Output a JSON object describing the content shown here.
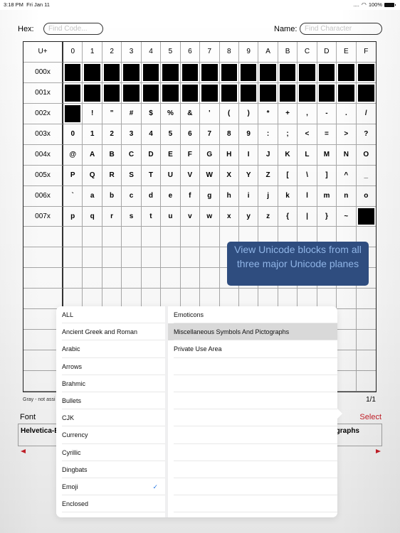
{
  "status_bar": {
    "time": "3:18 PM",
    "date": "Fri Jan 11",
    "signal": "....",
    "battery_percent": "100%"
  },
  "search": {
    "hex_label": "Hex:",
    "hex_placeholder": "Find Code...",
    "name_label": "Name:",
    "name_placeholder": "Find Character"
  },
  "grid": {
    "corner": "U+",
    "col_headers": [
      "0",
      "1",
      "2",
      "3",
      "4",
      "5",
      "6",
      "7",
      "8",
      "9",
      "A",
      "B",
      "C",
      "D",
      "E",
      "F"
    ],
    "rows": [
      {
        "label": "000x",
        "cells": [
          "■",
          "■",
          "■",
          "■",
          "■",
          "■",
          "■",
          "■",
          "■",
          "■",
          "■",
          "■",
          "■",
          "■",
          "■",
          "■"
        ]
      },
      {
        "label": "001x",
        "cells": [
          "■",
          "■",
          "■",
          "■",
          "■",
          "■",
          "■",
          "■",
          "■",
          "■",
          "■",
          "■",
          "■",
          "■",
          "■",
          "■"
        ]
      },
      {
        "label": "002x",
        "cells": [
          "■",
          "!",
          "\"",
          "#",
          "$",
          "%",
          "&",
          "'",
          "(",
          ")",
          "*",
          "+",
          ",",
          "-",
          ".",
          "/"
        ]
      },
      {
        "label": "003x",
        "cells": [
          "0",
          "1",
          "2",
          "3",
          "4",
          "5",
          "6",
          "7",
          "8",
          "9",
          ":",
          ";",
          "<",
          "=",
          ">",
          "?"
        ]
      },
      {
        "label": "004x",
        "cells": [
          "@",
          "A",
          "B",
          "C",
          "D",
          "E",
          "F",
          "G",
          "H",
          "I",
          "J",
          "K",
          "L",
          "M",
          "N",
          "O"
        ]
      },
      {
        "label": "005x",
        "cells": [
          "P",
          "Q",
          "R",
          "S",
          "T",
          "U",
          "V",
          "W",
          "X",
          "Y",
          "Z",
          "[",
          "\\",
          "]",
          "^",
          "_"
        ]
      },
      {
        "label": "006x",
        "cells": [
          "`",
          "a",
          "b",
          "c",
          "d",
          "e",
          "f",
          "g",
          "h",
          "i",
          "j",
          "k",
          "l",
          "m",
          "n",
          "o"
        ]
      },
      {
        "label": "007x",
        "cells": [
          "p",
          "q",
          "r",
          "s",
          "t",
          "u",
          "v",
          "w",
          "x",
          "y",
          "z",
          "{",
          "|",
          "}",
          "~",
          "■"
        ]
      },
      {
        "label": "",
        "cells": [
          "",
          "",
          "",
          "",
          "",
          "",
          "",
          "",
          "",
          "",
          "",
          "",
          "",
          "",
          "",
          ""
        ]
      },
      {
        "label": "",
        "cells": [
          "",
          "",
          "",
          "",
          "",
          "",
          "",
          "",
          "",
          "",
          "",
          "",
          "",
          "",
          "",
          ""
        ]
      },
      {
        "label": "",
        "cells": [
          "",
          "",
          "",
          "",
          "",
          "",
          "",
          "",
          "",
          "",
          "",
          "",
          "",
          "",
          "",
          ""
        ]
      },
      {
        "label": "",
        "cells": [
          "",
          "",
          "",
          "",
          "",
          "",
          "",
          "",
          "",
          "",
          "",
          "",
          "",
          "",
          "",
          ""
        ]
      },
      {
        "label": "",
        "cells": [
          "",
          "",
          "",
          "",
          "",
          "",
          "",
          "",
          "",
          "",
          "",
          "",
          "",
          "",
          "",
          ""
        ]
      },
      {
        "label": "",
        "cells": [
          "",
          "",
          "",
          "",
          "",
          "",
          "",
          "",
          "",
          "",
          "",
          "",
          "",
          "",
          "",
          ""
        ]
      },
      {
        "label": "",
        "cells": [
          "",
          "",
          "",
          "",
          "",
          "",
          "",
          "",
          "",
          "",
          "",
          "",
          "",
          "",
          "",
          ""
        ]
      },
      {
        "label": "",
        "cells": [
          "",
          "",
          "",
          "",
          "",
          "",
          "",
          "",
          "",
          "",
          "",
          "",
          "",
          "",
          "",
          ""
        ]
      }
    ]
  },
  "legend_text": "Gray - not assi",
  "page_count": "1/1",
  "font_section": {
    "label": "Font",
    "select_label": "Select",
    "font_name": "Helvetica-B",
    "block_name": "graphs"
  },
  "tooltip": "View Unicode blocks from all three major Unicode planes",
  "popover": {
    "categories": [
      {
        "label": "ALL",
        "checked": false
      },
      {
        "label": "Ancient Greek and Roman",
        "checked": false
      },
      {
        "label": "Arabic",
        "checked": false
      },
      {
        "label": "Arrows",
        "checked": false
      },
      {
        "label": "Brahmic",
        "checked": false
      },
      {
        "label": "Bullets",
        "checked": false
      },
      {
        "label": "CJK",
        "checked": false
      },
      {
        "label": "Currency",
        "checked": false
      },
      {
        "label": "Cyrillic",
        "checked": false
      },
      {
        "label": "Dingbats",
        "checked": false
      },
      {
        "label": "Emoji",
        "checked": true
      },
      {
        "label": "Enclosed",
        "checked": false
      }
    ],
    "check_glyph": "✓",
    "blocks": [
      {
        "label": "Emoticons",
        "selected": false
      },
      {
        "label": "Miscellaneous Symbols And Pictographs",
        "selected": true
      },
      {
        "label": "Private Use Area",
        "selected": false
      }
    ]
  }
}
